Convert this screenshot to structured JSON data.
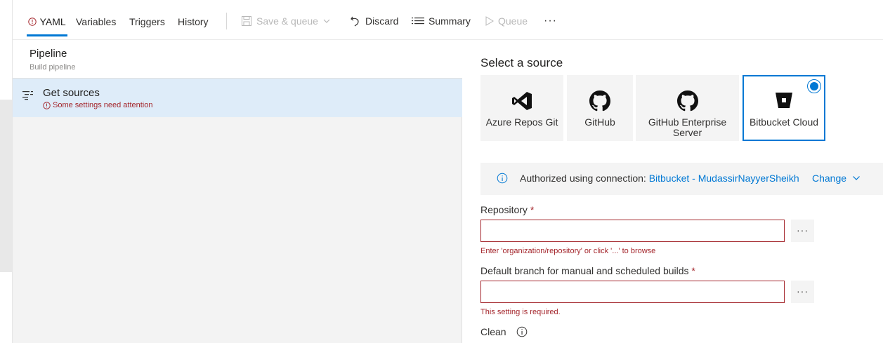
{
  "toolbar": {
    "tabs": [
      {
        "label": "YAML",
        "active": true,
        "warning": true
      },
      {
        "label": "Variables"
      },
      {
        "label": "Triggers"
      },
      {
        "label": "History"
      }
    ],
    "save_queue_label": "Save & queue",
    "discard_label": "Discard",
    "summary_label": "Summary",
    "queue_label": "Queue",
    "more_label": "···"
  },
  "left": {
    "pipeline_title": "Pipeline",
    "pipeline_subtitle": "Build pipeline",
    "get_sources_title": "Get sources",
    "get_sources_warning": "Some settings need attention"
  },
  "right": {
    "select_source_title": "Select a source",
    "sources": [
      {
        "label": "Azure Repos Git",
        "icon": "visual-studio-icon"
      },
      {
        "label": "GitHub",
        "icon": "github-icon"
      },
      {
        "label": "GitHub Enterprise Server",
        "icon": "github-icon"
      },
      {
        "label": "Bitbucket Cloud",
        "icon": "bitbucket-icon",
        "selected": true
      }
    ],
    "auth_prefix": "Authorized using connection:",
    "auth_connection": "Bitbucket - MudassirNayyerSheikh",
    "change_label": "Change",
    "repository_label": "Repository",
    "required_mark": "*",
    "repository_value": "",
    "repository_error": "Enter 'organization/repository' or click '...' to browse",
    "branch_label": "Default branch for manual and scheduled builds",
    "branch_value": "",
    "branch_error": "This setting is required.",
    "browse_label": "···",
    "clean_label": "Clean"
  },
  "colors": {
    "accent": "#0078d4",
    "error": "#a4262c",
    "selected_row": "#deecf9"
  }
}
